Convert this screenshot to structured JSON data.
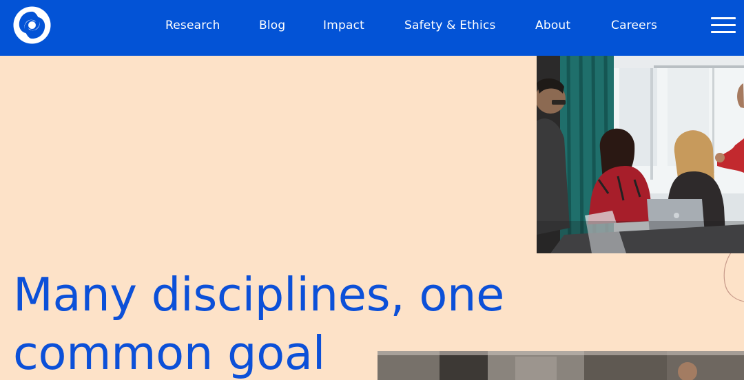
{
  "header": {
    "logo_icon": "deepmind-logo-icon",
    "nav": [
      {
        "label": "Research"
      },
      {
        "label": "Blog"
      },
      {
        "label": "Impact"
      },
      {
        "label": "Safety & Ethics"
      },
      {
        "label": "About"
      },
      {
        "label": "Careers"
      }
    ],
    "menu_icon": "hamburger-menu-icon"
  },
  "hero": {
    "headline_line1": "Many disciplines, one",
    "headline_line2": "common goal"
  },
  "colors": {
    "nav_background": "#0353d6",
    "page_background": "#fde2c8",
    "headline": "#0c50d8"
  }
}
